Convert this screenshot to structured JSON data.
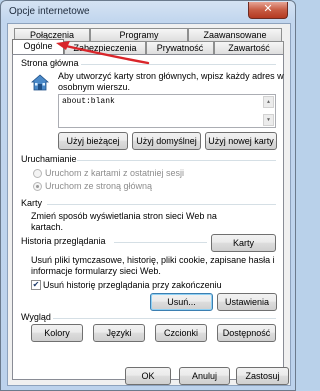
{
  "window": {
    "title": "Opcje internetowe",
    "close_symbol": "✕"
  },
  "tabs": {
    "row1": [
      "Połączenia",
      "Programy",
      "Zaawansowane"
    ],
    "row2": [
      "Ogólne",
      "Zabezpieczenia",
      "Prywatność",
      "Zawartość"
    ],
    "active": "Ogólne"
  },
  "home": {
    "heading": "Strona główna",
    "desc_line1": "Aby utworzyć karty stron głównych, wpisz każdy adres w",
    "desc_line2": "osobnym wierszu.",
    "url": "about:blank",
    "btn_current": "Użyj bieżącej",
    "btn_default": "Użyj domyślnej",
    "btn_new_tab": "Użyj nowej karty"
  },
  "startup": {
    "heading": "Uruchamianie",
    "option_last_session": "Uruchom z kartami z ostatniej sesji",
    "option_home": "Uruchom ze stroną główną",
    "selected": "option_home"
  },
  "tabs_section": {
    "heading": "Karty",
    "desc_line1": "Zmień sposób wyświetlania stron sieci Web na",
    "desc_line2": "kartach.",
    "button": "Karty"
  },
  "history": {
    "heading": "Historia przeglądania",
    "desc_line1": "Usuń pliki tymczasowe, historię, pliki cookie, zapisane hasła i",
    "desc_line2": "informacje formularzy sieci Web.",
    "checkbox_label": "Usuń historię przeglądania przy zakończeniu",
    "checked": true,
    "btn_delete": "Usuń...",
    "btn_settings": "Ustawienia"
  },
  "appearance": {
    "heading": "Wygląd",
    "btn_colors": "Kolory",
    "btn_languages": "Języki",
    "btn_fonts": "Czcionki",
    "btn_accessibility": "Dostępność"
  },
  "footer": {
    "ok": "OK",
    "cancel": "Anuluj",
    "apply": "Zastosuj"
  },
  "colors": {
    "accent_arrow": "#d9252a"
  }
}
